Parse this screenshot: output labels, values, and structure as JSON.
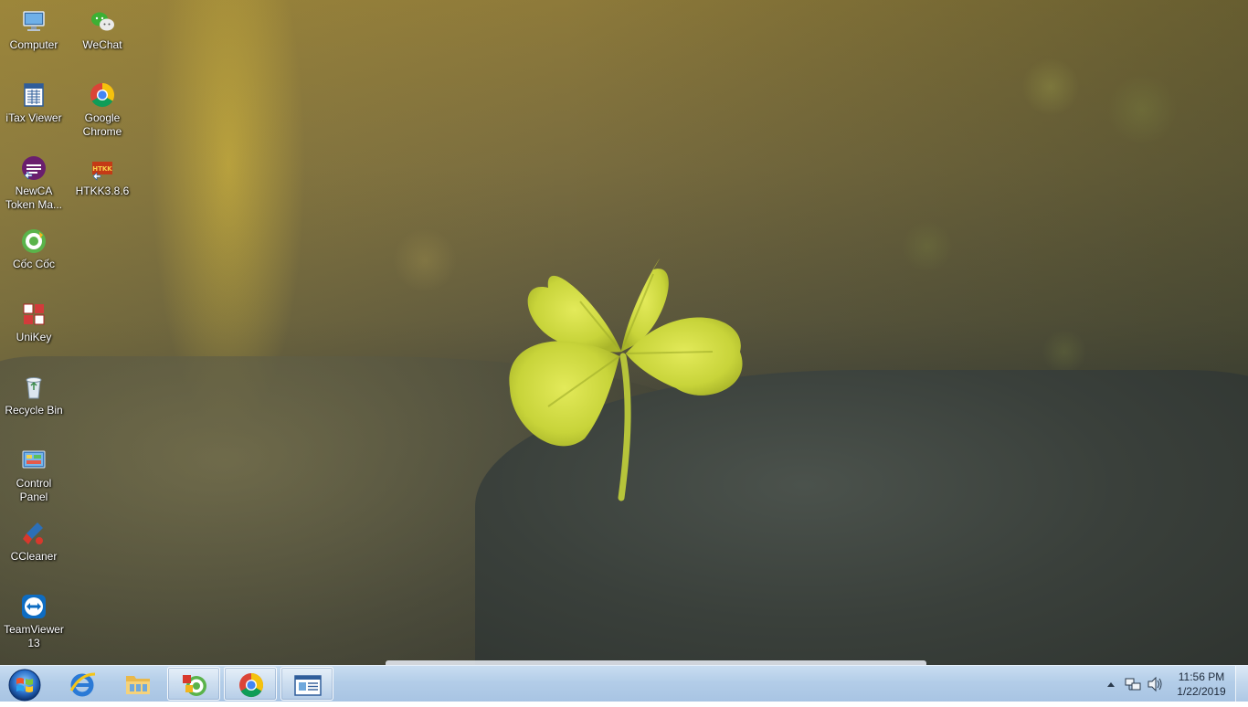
{
  "desktop": {
    "icons": [
      {
        "name": "Computer"
      },
      {
        "name": "WeChat"
      },
      {
        "name": "iTax Viewer"
      },
      {
        "name": "Google Chrome"
      },
      {
        "name": "NewCA Token Ma..."
      },
      {
        "name": "HTKK3.8.6"
      },
      {
        "name": "Cốc Cốc"
      },
      {
        "name": "UniKey"
      },
      {
        "name": "Recycle Bin"
      },
      {
        "name": "Control Panel"
      },
      {
        "name": "CCleaner"
      },
      {
        "name": "TeamViewer 13"
      }
    ],
    "htkk_badge_text": "HTKK"
  },
  "taskbar": {
    "start_icon": "windows-start-orb",
    "pinned": [
      {
        "icon": "internet-explorer-icon"
      },
      {
        "icon": "file-explorer-icon"
      },
      {
        "icon": "coc-coc-icon",
        "open": true
      },
      {
        "icon": "google-chrome-icon",
        "open": true
      },
      {
        "icon": "itax-viewer-icon",
        "open": true
      }
    ],
    "tray": {
      "icons": [
        "show-hidden-icons-arrow",
        "network-icon",
        "volume-icon"
      ],
      "time": "11:56 PM",
      "date": "1/22/2019"
    }
  },
  "colors": {
    "taskbar": "#b3cde8",
    "clover_leaf": "#c8d43a",
    "accent_chrome_red": "#db4437",
    "accent_chrome_yellow": "#f4c20d",
    "accent_chrome_green": "#0f9d58",
    "accent_chrome_blue": "#4285f4"
  }
}
